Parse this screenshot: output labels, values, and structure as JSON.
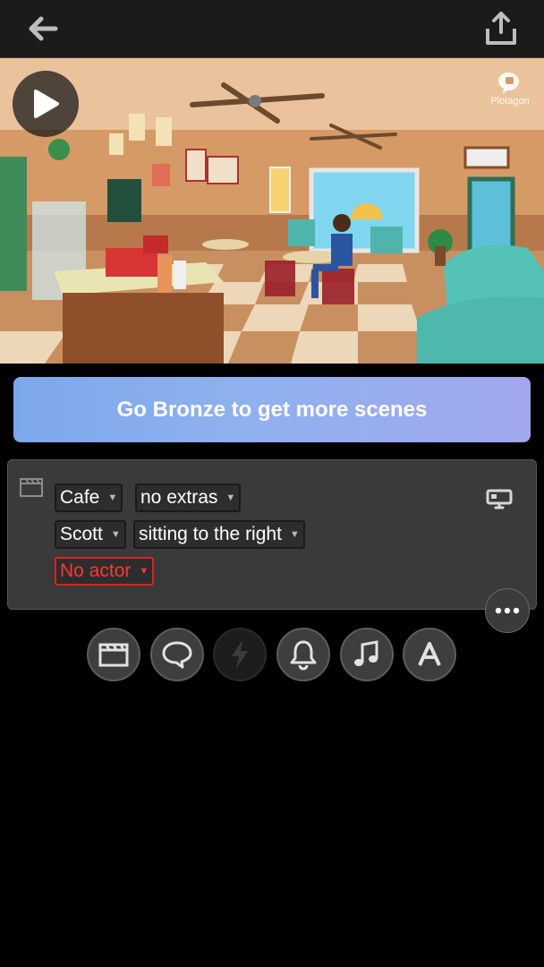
{
  "topbar": {
    "back_icon": "back-arrow-icon",
    "share_icon": "share-upload-icon"
  },
  "preview": {
    "play_icon": "play-icon",
    "logo_text": "Plotagon"
  },
  "banner": {
    "label": "Go Bronze to get more scenes"
  },
  "scene": {
    "location": "Cafe",
    "extras": "no extras",
    "actor1": "Scott",
    "actor1_position": "sitting to the right",
    "actor2": "No actor",
    "clapper_icon": "clapperboard-icon",
    "camera_icon": "camera-icon"
  },
  "more_icon": "more-horizontal-icon",
  "toolbar": [
    {
      "name": "scene",
      "icon": "clapperboard-icon",
      "enabled": true
    },
    {
      "name": "dialogue",
      "icon": "speech-bubble-icon",
      "enabled": true
    },
    {
      "name": "action",
      "icon": "lightning-icon",
      "enabled": false
    },
    {
      "name": "sound-effect",
      "icon": "bell-icon",
      "enabled": true
    },
    {
      "name": "music",
      "icon": "music-note-icon",
      "enabled": true
    },
    {
      "name": "text",
      "icon": "text-a-icon",
      "enabled": true
    }
  ],
  "colors": {
    "accent_blue": "#7da7ec",
    "warning_red": "#e02020",
    "card_bg": "#3a3a3a"
  }
}
